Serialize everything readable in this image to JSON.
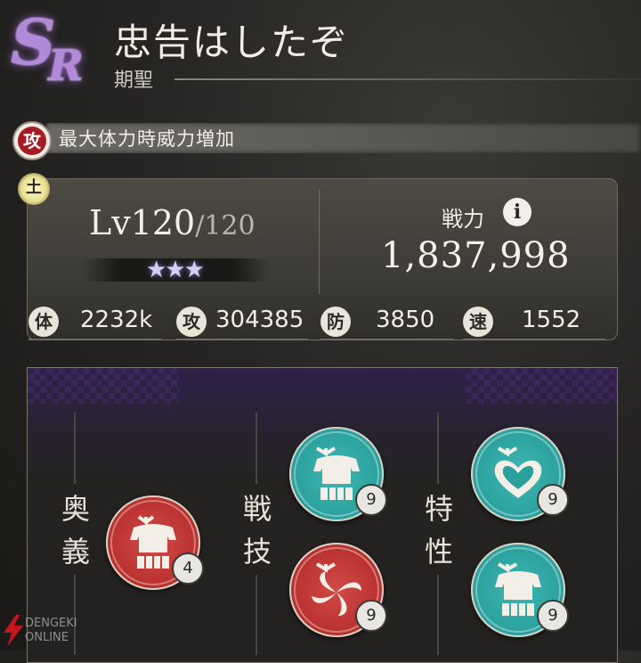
{
  "header": {
    "rarity_s": "S",
    "rarity_r": "R",
    "title": "忠告はしたぞ",
    "subtitle": "期聖"
  },
  "ability": {
    "badge": "攻",
    "text": "最大体力時威力増加"
  },
  "stats": {
    "element": "土",
    "level": "Lv120",
    "level_max": "/120",
    "star_rank": 3,
    "power_label": "戦力",
    "info_symbol": "i",
    "power_value": "1,837,998",
    "hp_label": "体",
    "hp_value": "2232k",
    "atk_label": "攻",
    "atk_value": "304385",
    "def_label": "防",
    "def_value": "3850",
    "spd_label": "速",
    "spd_value": "1552"
  },
  "skills": {
    "ougi_label": "奥義",
    "senggi_label": "戦技",
    "tokusei_label": "特性",
    "items": [
      {
        "icon": "armor-icon",
        "color": "red",
        "count": "4"
      },
      {
        "icon": "armor-icon",
        "color": "teal",
        "count": "9"
      },
      {
        "icon": "swirl-icon",
        "color": "red",
        "count": "9"
      },
      {
        "icon": "heart-icon",
        "color": "teal",
        "count": "9"
      },
      {
        "icon": "armor-icon",
        "color": "teal",
        "count": "9"
      }
    ]
  },
  "watermark": {
    "line1": "DENGEKI",
    "line2": "ONLINE"
  },
  "colors": {
    "skill_red": "#b8302e",
    "skill_teal": "#2a9f9c",
    "attack_badge": "#a51b23",
    "rarity_glow": "#b38ad9"
  }
}
